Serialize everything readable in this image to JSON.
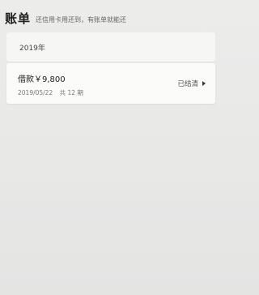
{
  "header": {
    "title": "账单",
    "subtitle": "还信用卡用还到，有账单就能还"
  },
  "bills": {
    "year": "2019年",
    "items": [
      {
        "amount": "借款￥9,800",
        "date": "2019/05/22",
        "term": "共 12 期",
        "status": "已结清"
      }
    ]
  },
  "icons": {
    "status_arrow": "arrow-right-icon"
  }
}
